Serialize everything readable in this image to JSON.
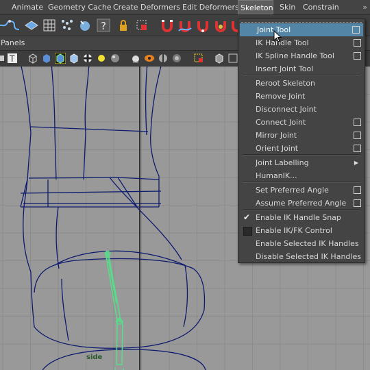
{
  "menubar": {
    "items": [
      "Animate",
      "Geometry Cache",
      "Create Deformers",
      "Edit Deformers",
      "Skeleton",
      "Skin",
      "Constrain"
    ],
    "active": "Skeleton",
    "more": "»"
  },
  "panel": {
    "label": "Panels"
  },
  "viewport": {
    "view_label": "side"
  },
  "skeleton_menu": {
    "items": [
      {
        "label": "Joint Tool",
        "option_box": true,
        "highlighted": true
      },
      {
        "label": "IK Handle Tool",
        "option_box": true
      },
      {
        "label": "IK Spline Handle Tool",
        "option_box": true
      },
      {
        "label": "Insert Joint Tool",
        "option_box": false
      },
      {
        "label": "Reroot Skeleton",
        "option_box": false
      },
      {
        "label": "Remove Joint",
        "option_box": false
      },
      {
        "label": "Disconnect Joint",
        "option_box": false
      },
      {
        "label": "Connect Joint",
        "option_box": true
      },
      {
        "label": "Mirror Joint",
        "option_box": true
      },
      {
        "label": "Orient Joint",
        "option_box": true
      },
      {
        "label": "Joint Labelling",
        "submenu": true
      },
      {
        "label": "HumanIK...",
        "option_box": false
      },
      {
        "label": "Set Preferred Angle",
        "option_box": true
      },
      {
        "label": "Assume Preferred Angle",
        "option_box": true
      },
      {
        "label": "Enable IK Handle Snap",
        "checked": true
      },
      {
        "label": "Enable IK/FK Control",
        "checked": false
      },
      {
        "label": "Enable Selected IK Handles"
      },
      {
        "label": "Disable Selected IK Handles"
      }
    ]
  },
  "colors": {
    "highlight": "#5285a6",
    "menu_bg": "#444444",
    "viewport_bg": "#999999",
    "wire": "#0c1a6e",
    "joint": "#55e088"
  }
}
